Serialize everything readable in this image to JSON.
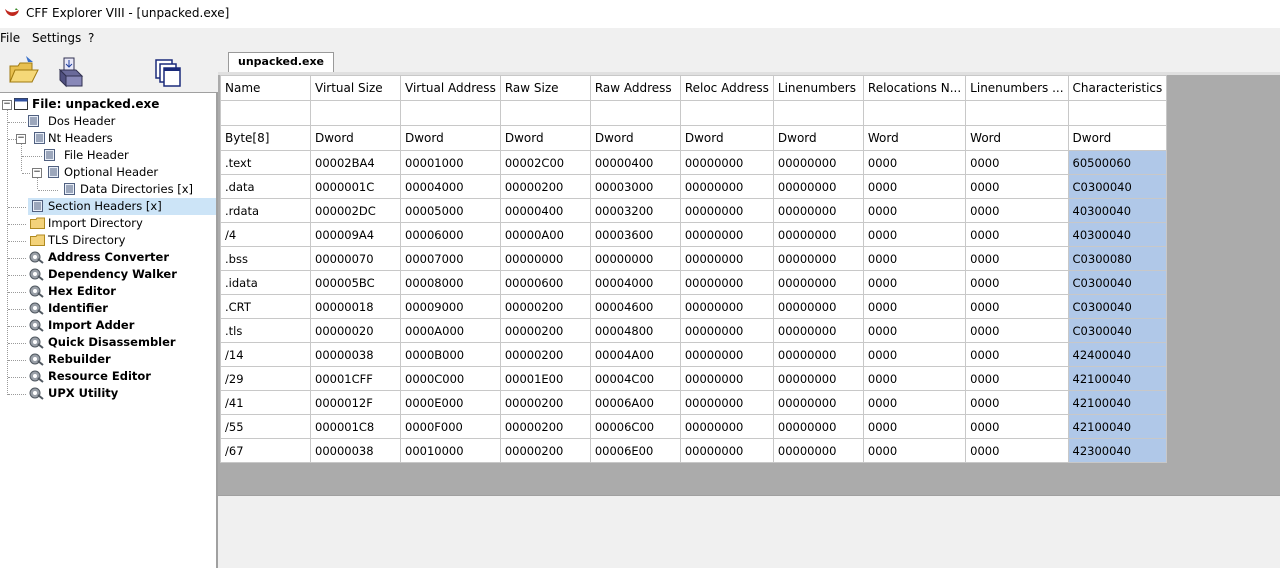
{
  "window": {
    "title": "CFF Explorer VIII - [unpacked.exe]"
  },
  "menu": {
    "items": [
      "File",
      "Settings",
      "?"
    ]
  },
  "toolbar": {
    "buttons": [
      "open-folder-icon",
      "save-disk-icon",
      "windows-icon"
    ]
  },
  "tab": {
    "label": "unpacked.exe"
  },
  "tree": {
    "items": [
      {
        "label": "File: unpacked.exe"
      },
      {
        "label": "Dos Header"
      },
      {
        "label": "Nt Headers"
      },
      {
        "label": "File Header"
      },
      {
        "label": "Optional Header"
      },
      {
        "label": "Data Directories [x]"
      },
      {
        "label": "Section Headers [x]"
      },
      {
        "label": "Import Directory"
      },
      {
        "label": "TLS Directory"
      },
      {
        "label": "Address Converter"
      },
      {
        "label": "Dependency Walker"
      },
      {
        "label": "Hex Editor"
      },
      {
        "label": "Identifier"
      },
      {
        "label": "Import Adder"
      },
      {
        "label": "Quick Disassembler"
      },
      {
        "label": "Rebuilder"
      },
      {
        "label": "Resource Editor"
      },
      {
        "label": "UPX Utility"
      }
    ]
  },
  "grid": {
    "columns": [
      "Name",
      "Virtual Size",
      "Virtual Address",
      "Raw Size",
      "Raw Address",
      "Reloc Address",
      "Linenumbers",
      "Relocations N...",
      "Linenumbers ...",
      "Characteristics"
    ],
    "types": [
      "Byte[8]",
      "Dword",
      "Dword",
      "Dword",
      "Dword",
      "Dword",
      "Dword",
      "Word",
      "Word",
      "Dword"
    ],
    "rows": [
      [
        ".text",
        "00002BA4",
        "00001000",
        "00002C00",
        "00000400",
        "00000000",
        "00000000",
        "0000",
        "0000",
        "60500060"
      ],
      [
        ".data",
        "0000001C",
        "00004000",
        "00000200",
        "00003000",
        "00000000",
        "00000000",
        "0000",
        "0000",
        "C0300040"
      ],
      [
        ".rdata",
        "000002DC",
        "00005000",
        "00000400",
        "00003200",
        "00000000",
        "00000000",
        "0000",
        "0000",
        "40300040"
      ],
      [
        "/4",
        "000009A4",
        "00006000",
        "00000A00",
        "00003600",
        "00000000",
        "00000000",
        "0000",
        "0000",
        "40300040"
      ],
      [
        ".bss",
        "00000070",
        "00007000",
        "00000000",
        "00000000",
        "00000000",
        "00000000",
        "0000",
        "0000",
        "C0300080"
      ],
      [
        ".idata",
        "000005BC",
        "00008000",
        "00000600",
        "00004000",
        "00000000",
        "00000000",
        "0000",
        "0000",
        "C0300040"
      ],
      [
        ".CRT",
        "00000018",
        "00009000",
        "00000200",
        "00004600",
        "00000000",
        "00000000",
        "0000",
        "0000",
        "C0300040"
      ],
      [
        ".tls",
        "00000020",
        "0000A000",
        "00000200",
        "00004800",
        "00000000",
        "00000000",
        "0000",
        "0000",
        "C0300040"
      ],
      [
        "/14",
        "00000038",
        "0000B000",
        "00000200",
        "00004A00",
        "00000000",
        "00000000",
        "0000",
        "0000",
        "42400040"
      ],
      [
        "/29",
        "00001CFF",
        "0000C000",
        "00001E00",
        "00004C00",
        "00000000",
        "00000000",
        "0000",
        "0000",
        "42100040"
      ],
      [
        "/41",
        "0000012F",
        "0000E000",
        "00000200",
        "00006A00",
        "00000000",
        "00000000",
        "0000",
        "0000",
        "42100040"
      ],
      [
        "/55",
        "000001C8",
        "0000F000",
        "00000200",
        "00006C00",
        "00000000",
        "00000000",
        "0000",
        "0000",
        "42100040"
      ],
      [
        "/67",
        "00000038",
        "00010000",
        "00000200",
        "00006E00",
        "00000000",
        "00000000",
        "0000",
        "0000",
        "42300040"
      ]
    ]
  },
  "colors": {
    "selection": "#cce4f7",
    "highlight_column": "#b0c8e8",
    "grid_bg": "#ababab"
  }
}
